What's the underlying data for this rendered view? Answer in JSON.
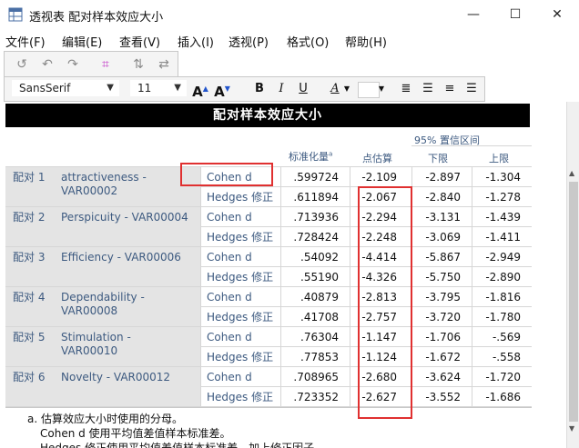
{
  "window": {
    "title": "透视表 配对样本效应大小",
    "minimize": "—",
    "maximize": "☐",
    "close": "✕"
  },
  "menu": [
    "文件(F)",
    "编辑(E)",
    "查看(V)",
    "插入(I)",
    "透视(P)",
    "格式(O)",
    "帮助(H)"
  ],
  "format_toolbar": {
    "font": "SansSerif",
    "size": "11",
    "grow": "A",
    "shrink": "A",
    "bold": "B",
    "italic": "I",
    "underline": "U",
    "color": "A"
  },
  "table": {
    "title": "配对样本效应大小",
    "headers": {
      "std": "标准化量",
      "std_sup": "a",
      "point": "点估算",
      "ci": "95% 置信区间",
      "lower": "下限",
      "upper": "上限"
    },
    "rows": [
      {
        "group": "配对 1",
        "variable": "attractiveness - VAR00002",
        "stat": "Cohen d",
        "std": ".599724",
        "point": "-2.109",
        "lower": "-2.897",
        "upper": "-1.304"
      },
      {
        "group": "",
        "variable": "",
        "stat": "Hedges 修正",
        "std": ".611894",
        "point": "-2.067",
        "lower": "-2.840",
        "upper": "-1.278"
      },
      {
        "group": "配对 2",
        "variable": "Perspicuity - VAR00004",
        "stat": "Cohen d",
        "std": ".713936",
        "point": "-2.294",
        "lower": "-3.131",
        "upper": "-1.439"
      },
      {
        "group": "",
        "variable": "",
        "stat": "Hedges 修正",
        "std": ".728424",
        "point": "-2.248",
        "lower": "-3.069",
        "upper": "-1.411"
      },
      {
        "group": "配对 3",
        "variable": "Efficiency - VAR00006",
        "stat": "Cohen d",
        "std": ".54092",
        "point": "-4.414",
        "lower": "-5.867",
        "upper": "-2.949"
      },
      {
        "group": "",
        "variable": "",
        "stat": "Hedges 修正",
        "std": ".55190",
        "point": "-4.326",
        "lower": "-5.750",
        "upper": "-2.890"
      },
      {
        "group": "配对 4",
        "variable": "Dependability - VAR00008",
        "stat": "Cohen d",
        "std": ".40879",
        "point": "-2.813",
        "lower": "-3.795",
        "upper": "-1.816"
      },
      {
        "group": "",
        "variable": "",
        "stat": "Hedges 修正",
        "std": ".41708",
        "point": "-2.757",
        "lower": "-3.720",
        "upper": "-1.780"
      },
      {
        "group": "配对 5",
        "variable": "Stimulation - VAR00010",
        "stat": "Cohen d",
        "std": ".76304",
        "point": "-1.147",
        "lower": "-1.706",
        "upper": "-.569"
      },
      {
        "group": "",
        "variable": "",
        "stat": "Hedges 修正",
        "std": ".77853",
        "point": "-1.124",
        "lower": "-1.672",
        "upper": "-.558"
      },
      {
        "group": "配对 6",
        "variable": "Novelty - VAR00012",
        "stat": "Cohen d",
        "std": ".708965",
        "point": "-2.680",
        "lower": "-3.624",
        "upper": "-1.720"
      },
      {
        "group": "",
        "variable": "",
        "stat": "Hedges 修正",
        "std": ".723352",
        "point": "-2.627",
        "lower": "-3.552",
        "upper": "-1.686"
      }
    ],
    "footnotes": [
      "a. 估算效应大小时使用的分母。",
      "Cohen d 使用平均值差值样本标准差。",
      "Hedges 修正使用平均值差值样本标准差，加上修正因子。"
    ]
  },
  "colors": {
    "highlight": "#e03030",
    "label": "#3d5a80",
    "title_bg": "#000000"
  }
}
